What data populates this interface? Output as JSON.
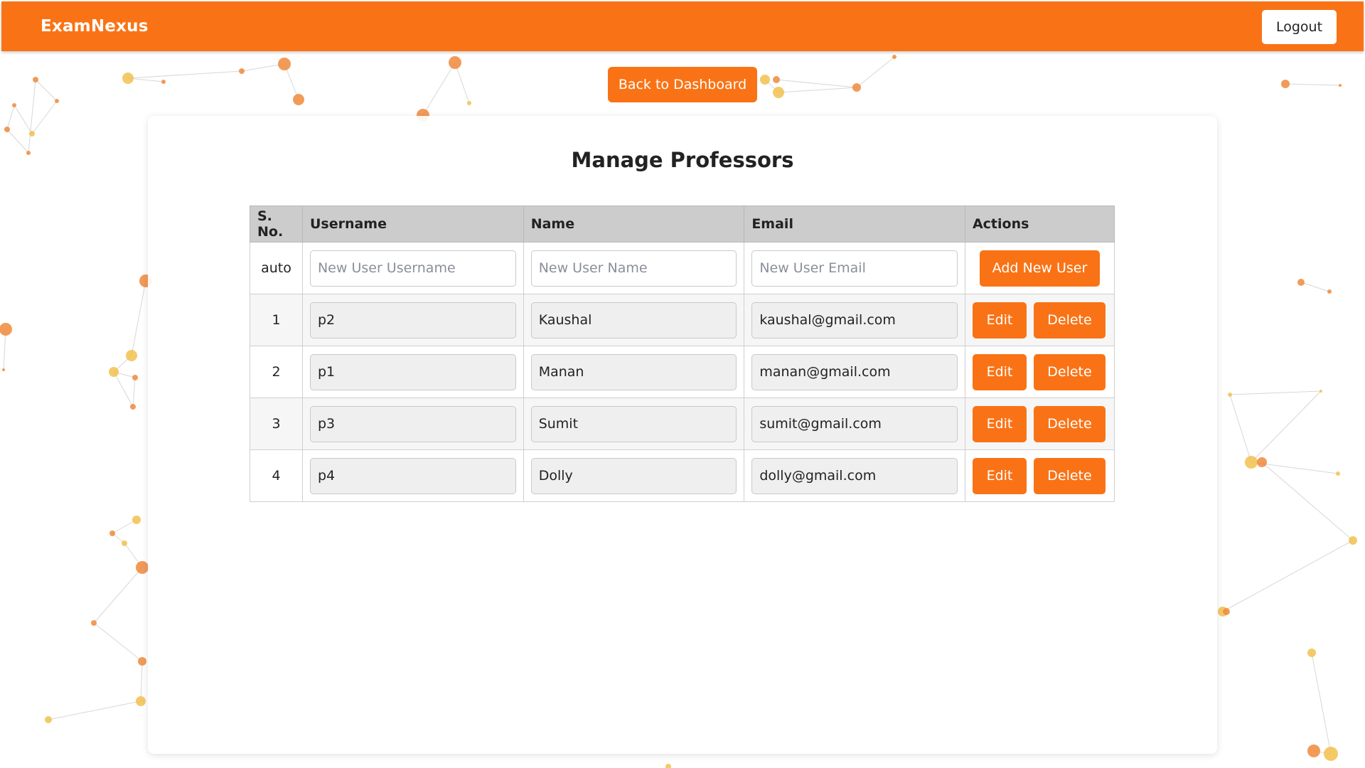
{
  "app": {
    "brand": "ExamNexus",
    "logout_label": "Logout",
    "back_label": "Back to Dashboard"
  },
  "page": {
    "title": "Manage Professors"
  },
  "table": {
    "headers": [
      "S. No.",
      "Username",
      "Name",
      "Email",
      "Actions"
    ],
    "new_row": {
      "sno": "auto",
      "username_placeholder": "New User Username",
      "name_placeholder": "New User Name",
      "email_placeholder": "New User Email",
      "add_label": "Add New User"
    },
    "edit_label": "Edit",
    "delete_label": "Delete",
    "rows": [
      {
        "sno": "1",
        "username": "p2",
        "name": "Kaushal",
        "email": "kaushal@gmail.com"
      },
      {
        "sno": "2",
        "username": "p1",
        "name": "Manan",
        "email": "manan@gmail.com"
      },
      {
        "sno": "3",
        "username": "p3",
        "name": "Sumit",
        "email": "sumit@gmail.com"
      },
      {
        "sno": "4",
        "username": "p4",
        "name": "Dolly",
        "email": "dolly@gmail.com"
      }
    ]
  },
  "colors": {
    "accent": "#f97316",
    "header_bg": "#cccccc",
    "particle_orange": "#f08a3c",
    "particle_yellow": "#f2c14e"
  },
  "icons": {
    "background": "network-particles-decoration"
  }
}
